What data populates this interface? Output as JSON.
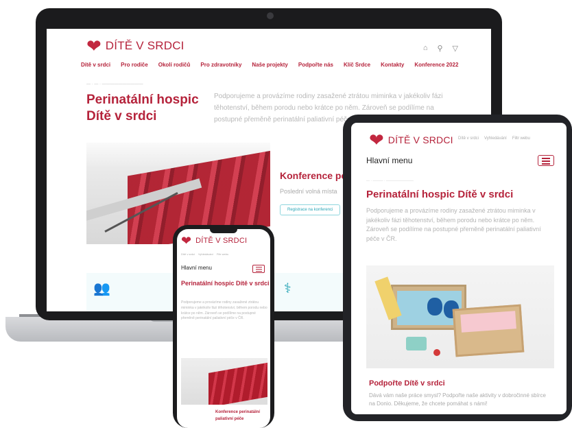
{
  "site": {
    "logo_text": "DÍTĚ V SRDCI",
    "nav": [
      "Dítě v srdci",
      "Pro rodiče",
      "Okolí rodičů",
      "Pro zdravotníky",
      "Naše projekty",
      "Podpořte nás",
      "Klíč Srdce",
      "Kontakty",
      "Konference 2022"
    ],
    "header_icons": [
      "home-icon",
      "search-icon",
      "filter-icon"
    ],
    "hero_title": "Perinatální hospic Dítě v srdci",
    "hero_text": "Podporujeme a provázíme rodiny zasažené ztrátou miminka v jakékoliv fázi těhotenství, během porodu nebo krátce po něm. Zároveň se podílíme na postupné přeměně perinatální paliativní péče v ČR.",
    "conference_title": "Konference pe",
    "conference_text": "Poslední volná místa",
    "conference_button": "Registrace na konferenci"
  },
  "tablet": {
    "logo_text": "DÍTĚ V SRDCI",
    "top_links": [
      "Dítě v srdci",
      "Vyhledávání",
      "Filtr webu"
    ],
    "menu_label": "Hlavní menu",
    "title": "Perinatální hospic Dítě v srdci",
    "text": "Podporujeme a provázíme rodiny zasažené ztrátou miminka v jakékoliv fázi těhotenství, během porodu nebo krátce po něm. Zároveň se podílíme na postupné přeměně perinatální paliativní péče v ČR.",
    "support_title": "Podpořte Dítě v srdci",
    "support_text": "Dává vám naše práce smysl? Podpořte naše aktivity v dobročinné sbírce na Donio. Děkujeme, že chcete pomáhat s námi!"
  },
  "phone": {
    "logo_text": "DÍTĚ V SRDCI",
    "top_links": [
      "Dítě v srdci",
      "Vyhledávání",
      "Filtr webu"
    ],
    "menu_label": "Hlavní menu",
    "title": "Perinatální hospic Dítě v srdci",
    "text": "Podporujeme a provázíme rodiny zasažené ztrátou miminka v jakékoliv fázi těhotenství, během porodu nebo krátce po něm. Zároveň se podílíme na postupné přeměně perinatální paliativní péče v ČR.",
    "conference": "Konference perinatální paliativní péče"
  },
  "colors": {
    "brand": "#b5233b",
    "accent": "#2aa6b7"
  }
}
